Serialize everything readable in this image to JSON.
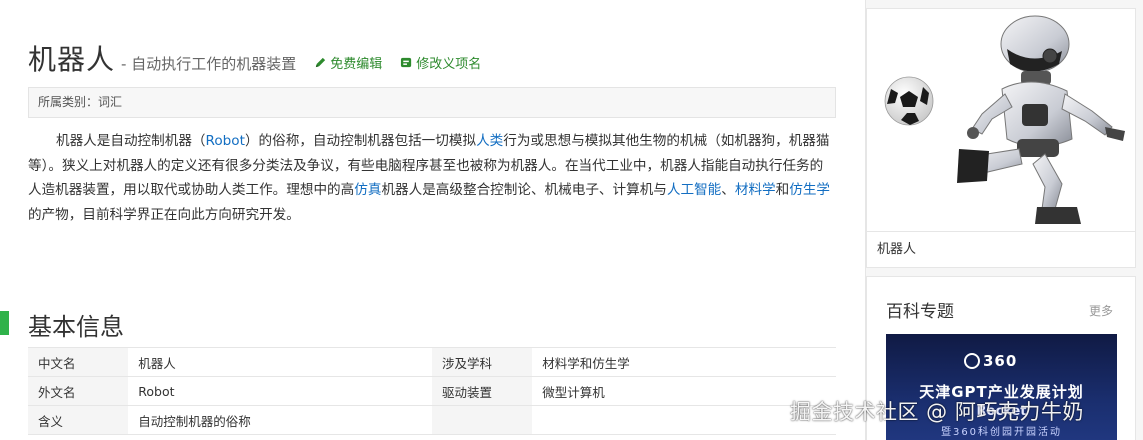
{
  "entry": {
    "title": "机器人",
    "subtitle": "- 自动执行工作的机器装置",
    "edit_label": "免费编辑",
    "rename_label": "修改义项名"
  },
  "category": {
    "text": "所属类别：词汇"
  },
  "summary": {
    "segments": [
      {
        "text": "机器人是自动控制机器（",
        "link": false
      },
      {
        "text": "Robot",
        "link": true
      },
      {
        "text": "）的俗称，自动控制机器包括一切模拟",
        "link": false
      },
      {
        "text": "人类",
        "link": true
      },
      {
        "text": "行为或思想与模拟其他生物的机械（如机器狗，机器猫等）。狭义上对机器人的定义还有很多分类法及争议，有些电脑程序甚至也被称为机器人。在当代工业中，机器人指能自动执行任务的人造机器装置，用以取代或协助人类工作。理想中的高",
        "link": false
      },
      {
        "text": "仿真",
        "link": true
      },
      {
        "text": "机器人是高级整合控制论、机械电子、计算机与",
        "link": false
      },
      {
        "text": "人工智能",
        "link": true
      },
      {
        "text": "、",
        "link": false
      },
      {
        "text": "材料学",
        "link": true
      },
      {
        "text": "和",
        "link": false
      },
      {
        "text": "仿生学",
        "link": true
      },
      {
        "text": "的产物，目前科学界正在向此方向研究开发。",
        "link": false
      }
    ]
  },
  "basic_info": {
    "heading": "基本信息",
    "rows": [
      {
        "k1": "中文名",
        "v1": "机器人",
        "k2": "涉及学科",
        "v2": "材料学和仿生学"
      },
      {
        "k1": "外文名",
        "v1": "Robot",
        "k2": "驱动装置",
        "v2": "微型计算机"
      },
      {
        "k1": "含义",
        "v1": "自动控制机器的俗称",
        "k2": "",
        "v2": ""
      }
    ]
  },
  "sidebar": {
    "image_caption": "机器人",
    "topic_title": "百科专题",
    "topic_more": "更多",
    "banner": {
      "logo_text": "360",
      "headline": "天津GPT产业发展计划",
      "line2": "Rocket",
      "line3": "暨360科创园开园活动"
    }
  },
  "watermark": "掘金技术社区 @ 阿巧克力牛奶",
  "colors": {
    "accent_green": "#2fb24a",
    "link_blue": "#136ec2",
    "action_green": "#2d8a2d"
  }
}
